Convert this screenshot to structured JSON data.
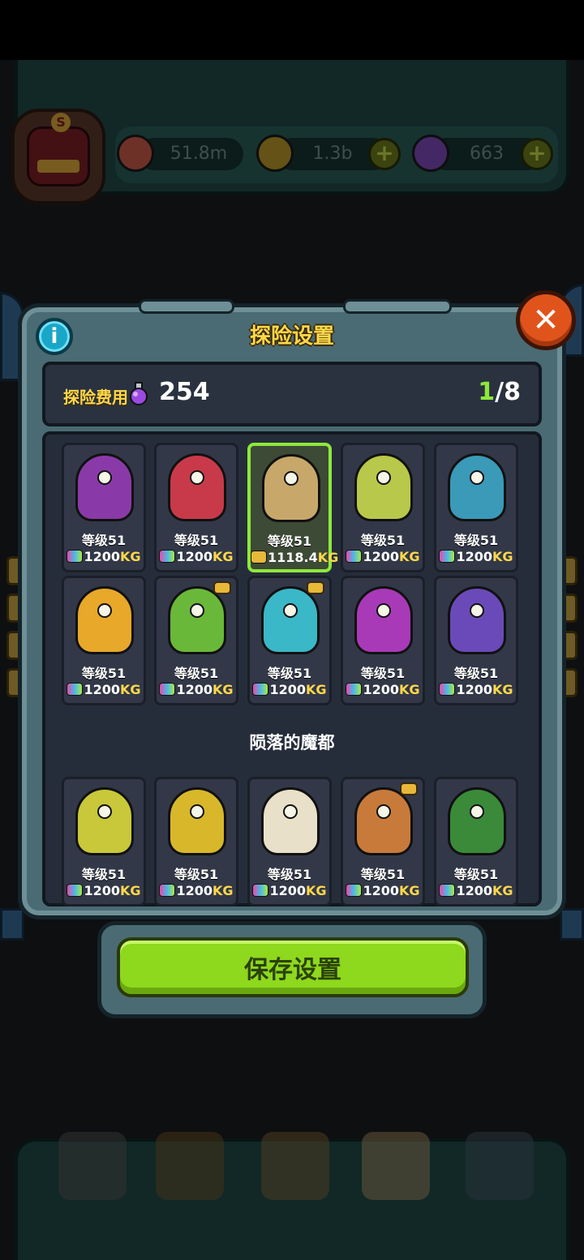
{
  "resources": {
    "eyeballs": "51.8m",
    "coins": "1.3b",
    "potions": "663"
  },
  "dialog": {
    "title": "探险设置",
    "cost_label": "探险费用",
    "cost_value": "254",
    "selected_count": "1",
    "max_count": "/8",
    "section_title": "陨落的魔都",
    "save_label": "保存设置"
  },
  "monsters_top": [
    {
      "level": "等级51",
      "weight": "1200",
      "unit": "KG",
      "color": "#8a3aa8",
      "selected": false
    },
    {
      "level": "等级51",
      "weight": "1200",
      "unit": "KG",
      "color": "#c83a4a",
      "selected": false
    },
    {
      "level": "等级51",
      "weight": "1118.4",
      "unit": "KG",
      "color": "#c8a86a",
      "selected": true
    },
    {
      "level": "等级51",
      "weight": "1200",
      "unit": "KG",
      "color": "#b8c84a",
      "selected": false
    },
    {
      "level": "等级51",
      "weight": "1200",
      "unit": "KG",
      "color": "#3a9ab8",
      "selected": false
    },
    {
      "level": "等级51",
      "weight": "1200",
      "unit": "KG",
      "color": "#e8a82a",
      "selected": false
    },
    {
      "level": "等级51",
      "weight": "1200",
      "unit": "KG",
      "color": "#6ab83a",
      "selected": false
    },
    {
      "level": "等级51",
      "weight": "1200",
      "unit": "KG",
      "color": "#3ab8c8",
      "selected": false
    },
    {
      "level": "等级51",
      "weight": "1200",
      "unit": "KG",
      "color": "#a83ab8",
      "selected": false
    },
    {
      "level": "等级51",
      "weight": "1200",
      "unit": "KG",
      "color": "#6a4ab8",
      "selected": false
    }
  ],
  "monsters_bottom": [
    {
      "level": "等级51",
      "weight": "1200",
      "unit": "KG",
      "color": "#c8c83a"
    },
    {
      "level": "等级51",
      "weight": "1200",
      "unit": "KG",
      "color": "#d8b82a"
    },
    {
      "level": "等级51",
      "weight": "1200",
      "unit": "KG",
      "color": "#e8e0c8"
    },
    {
      "level": "等级51",
      "weight": "1200",
      "unit": "KG",
      "color": "#c87a3a"
    },
    {
      "level": "等级51",
      "weight": "1200",
      "unit": "KG",
      "color": "#3a8a3a"
    }
  ]
}
